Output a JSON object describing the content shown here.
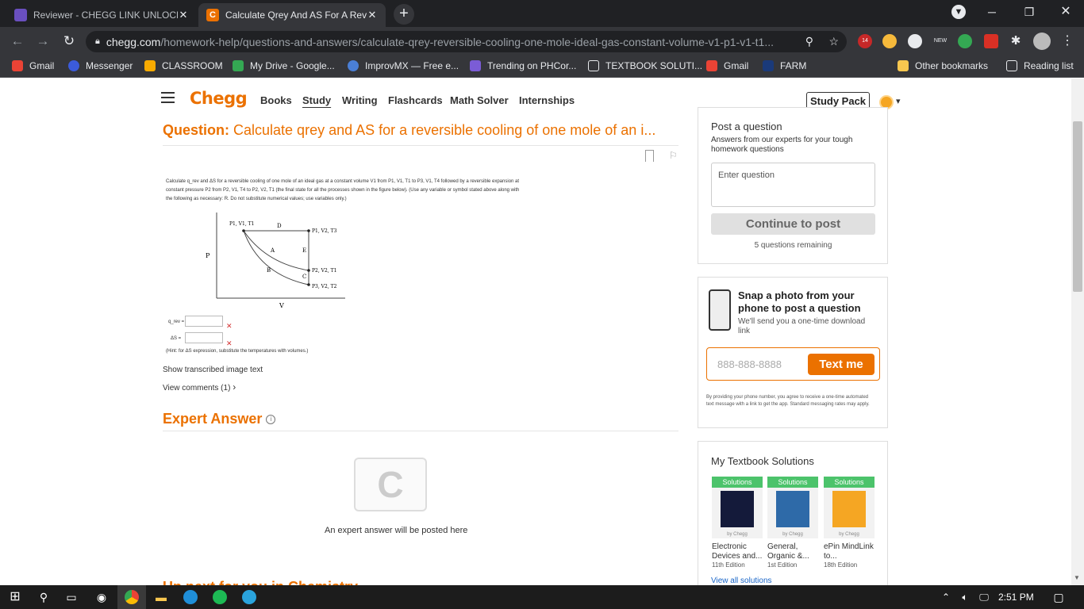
{
  "browser": {
    "tabs": [
      {
        "title": "Reviewer - CHEGG LINK UNLOCK",
        "active": false
      },
      {
        "title": "Calculate Qrey And AS For A Reve",
        "active": true
      }
    ],
    "url_host": "chegg.com",
    "url_path": "/homework-help/questions-and-answers/calculate-qrey-reversible-cooling-one-mole-ideal-gas-constant-volume-v1-p1-v1-t1...",
    "bookmarks": [
      "Gmail",
      "Messenger",
      "CLASSROOM",
      "My Drive - Google...",
      "ImprovMX — Free e...",
      "Trending on PHCor...",
      "TEXTBOOK SOLUTI...",
      "Gmail",
      "FARM"
    ],
    "other_bookmarks": "Other bookmarks",
    "reading_list": "Reading list",
    "ext_badges": {
      "ud": "14",
      "new": "NEW"
    }
  },
  "site": {
    "logo": "Chegg",
    "nav": [
      "Books",
      "Study",
      "Writing",
      "Flashcards",
      "Math Solver",
      "Internships"
    ],
    "active_nav": "Study",
    "study_pack": "Study Pack"
  },
  "question": {
    "label": "Question:",
    "title": "Calculate qrey and AS for a reversible cooling of one mole of an i...",
    "text_lines": [
      "Calculate q_rev and ΔS for a reversible cooling of one mole of an ideal gas at a constant volume V1 from P1, V1, T1 to P3, V1, T4 followed by a reversible expansion at",
      "constant pressure P2 from P2, V1, T4 to P2, V2, T1 (the final state for all the processes shown in the figure below). (Use any variable or symbol stated above along with",
      "the following as necessary: R. Do not substitute numerical values; use variables only.)"
    ],
    "diagram": {
      "y_axis": "P",
      "x_axis": "V",
      "point_labels": [
        "P1, V1, T1",
        "P1, V2, T3",
        "P2, V2, T1",
        "P3, V2, T2"
      ],
      "path_labels": [
        "D",
        "A",
        "E",
        "B",
        "C"
      ]
    },
    "answer_labels": [
      "q_rev =",
      "ΔS ="
    ],
    "hint": "(Hint: for ΔS expression, substitute the temperatures with volumes.)",
    "show_transcribed": "Show transcribed image text",
    "view_comments": "View comments (1)"
  },
  "expert": {
    "title": "Expert Answer",
    "placeholder": "An expert answer will be posted here",
    "icon_letter": "C"
  },
  "up_next": "Up next for you in Chemistry",
  "sidebar": {
    "post_title": "Post a question",
    "post_sub": "Answers from our experts for your tough homework questions",
    "input_placeholder": "Enter question",
    "continue": "Continue to post",
    "remaining": "5 questions remaining",
    "snap_title": "Snap a photo from your phone to post a question",
    "snap_sub": "We'll send you a one-time download link",
    "phone_placeholder": "888-888-8888",
    "text_me": "Text me",
    "disclaimer": "By providing your phone number, you agree to receive a one-time automated text message with a link to get the app. Standard messaging rates may apply.",
    "tb_title": "My Textbook Solutions",
    "textbooks": [
      {
        "badge": "Solutions",
        "by": "by Chegg",
        "name": "Electronic Devices and...",
        "edition": "11th Edition"
      },
      {
        "badge": "Solutions",
        "by": "by Chegg",
        "name": "General, Organic &...",
        "edition": "1st Edition"
      },
      {
        "badge": "Solutions",
        "by": "by Chegg",
        "name": "ePin MindLink to...",
        "edition": "18th Edition"
      }
    ],
    "view_all": "View all solutions"
  },
  "taskbar": {
    "time": "2:51 PM"
  },
  "colors": {
    "accent": "#eb7100",
    "green": "#4cc36b",
    "chrome_dark": "#202124",
    "chrome": "#35363a"
  }
}
